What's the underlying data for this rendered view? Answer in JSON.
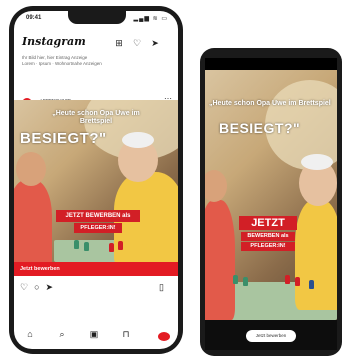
{
  "iphone": {
    "status_time": "09:41",
    "status_icons": "▂▄▆ ≋ ▭",
    "app_title": "Instagram",
    "header_icons": [
      "plus-square-icon",
      "heart-icon",
      "send-icon"
    ],
    "meta_line1": "Ihr Bild hier, hier Eintrag Anzeige",
    "meta_line2": "Lorem · Ipsum · Wohnortnahe Anzeigen",
    "post_user": "LEBENSHILFE",
    "post_sub": "Gesponsert",
    "ad": {
      "headline": "„Heute schon Opa Uwe im Brettspiel",
      "big": "BESIEGT?\"",
      "cta_line1": "JETZT BEWERBEN als",
      "cta_line2": "PFLEGER:IN!"
    },
    "apply_label": "Jetzt bewerben",
    "bottom_nav": [
      "home-icon",
      "search-icon",
      "reels-icon",
      "shop-icon",
      "profile-icon"
    ]
  },
  "android": {
    "ad": {
      "headline": "„Heute schon Opa Uwe im Brettspiel",
      "big": "BESIEGT?\"",
      "cta_line1": "JETZT",
      "cta_line2": "BEWERBEN als",
      "cta_line3": "PFLEGER:IN!"
    },
    "pill_label": "Jetzt bewerben"
  },
  "colors": {
    "brand_red": "#e31b23",
    "phone_frame": "#1a1a1a"
  }
}
